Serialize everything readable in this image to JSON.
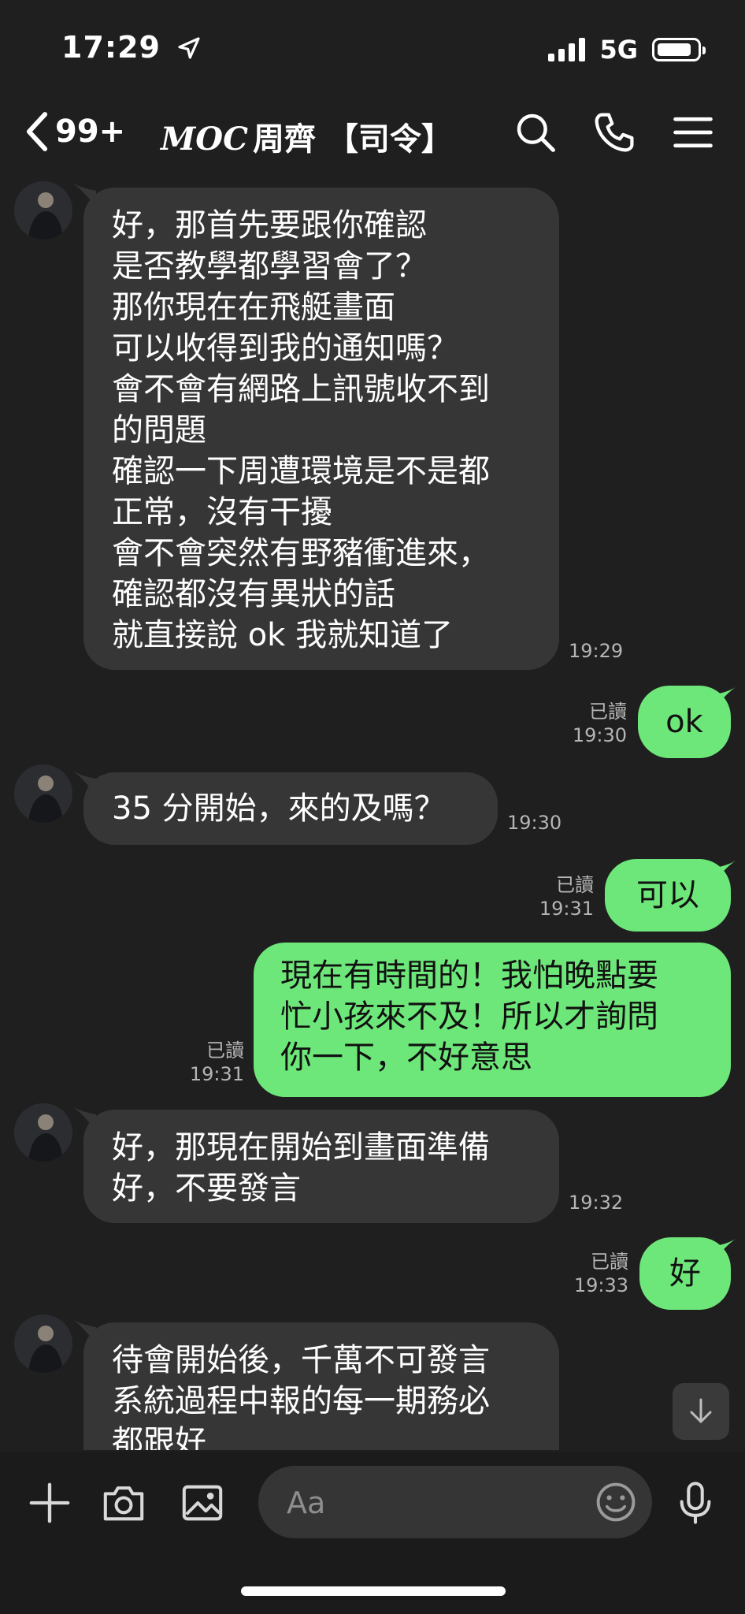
{
  "status_bar": {
    "time": "17:29",
    "network": "5G"
  },
  "nav": {
    "back_count": "99+",
    "title_prefix": "MOC",
    "title_suffix": "周齊 【司令】"
  },
  "messages": [
    {
      "side": "in",
      "text": "好，那首先要跟你確認\n是否教學都學習會了？\n那你現在在飛艇畫面\n可以收得到我的通知嗎？\n會不會有網路上訊號收不到\n的問題\n確認一下周遭環境是不是都\n正常，沒有干擾\n會不會突然有野豬衝進來，\n確認都沒有異狀的話\n就直接說 ok 我就知道了",
      "time": "19:29"
    },
    {
      "side": "out",
      "text": "ok",
      "read": "已讀",
      "time": "19:30"
    },
    {
      "side": "in",
      "text": "35 分開始，來的及嗎？",
      "time": "19:30"
    },
    {
      "side": "out",
      "text": "可以",
      "read": "已讀",
      "time": "19:31"
    },
    {
      "side": "out",
      "text": "現在有時間的！我怕晚點要\n忙小孩來不及！所以才詢問\n你一下，不好意思",
      "read": "已讀",
      "time": "19:31"
    },
    {
      "side": "in",
      "text": "好，那現在開始到畫面準備\n好，不要發言",
      "time": "19:32"
    },
    {
      "side": "out",
      "text": "好",
      "read": "已讀",
      "time": "19:33"
    },
    {
      "side": "in",
      "text": "待會開始後，千萬不可發言\n系統過程中報的每一期務必\n都跟好",
      "time": ""
    }
  ],
  "input": {
    "placeholder": "Aa"
  },
  "colors": {
    "background": "#1f1f1f",
    "incoming_bubble": "#363636",
    "outgoing_bubble": "#6ee77a"
  }
}
